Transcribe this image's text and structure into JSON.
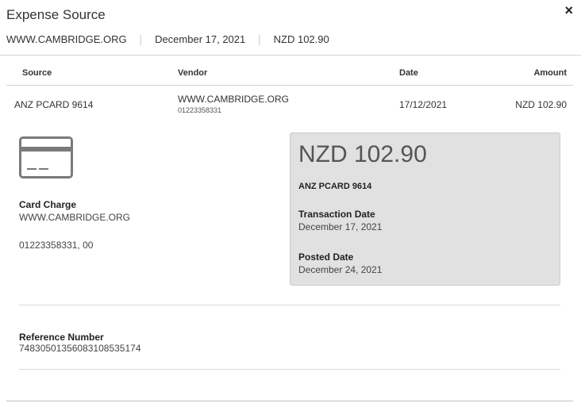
{
  "header": {
    "title": "Expense Source",
    "close_glyph": "×",
    "vendor": "WWW.CAMBRIDGE.ORG",
    "date": "December 17, 2021",
    "amount": "NZD 102.90",
    "separator": "|"
  },
  "table": {
    "columns": [
      "Source",
      "Vendor",
      "Date",
      "Amount"
    ],
    "row": {
      "source": "ANZ PCARD 9614",
      "vendor": "WWW.CAMBRIDGE.ORG",
      "vendor_phone": "01223358331",
      "date": "17/12/2021",
      "amount": "NZD 102.90"
    }
  },
  "details": {
    "icon": "credit-card-icon",
    "charge_label": "Card Charge",
    "charge_vendor": "WWW.CAMBRIDGE.ORG",
    "charge_ref": "01223358331, 00"
  },
  "panel": {
    "amount": "NZD 102.90",
    "card": "ANZ PCARD 9614",
    "transaction_date_label": "Transaction Date",
    "transaction_date": "December 17, 2021",
    "posted_date_label": "Posted Date",
    "posted_date": "December 24, 2021"
  },
  "reference": {
    "label": "Reference Number",
    "value": "74830501356083108535174"
  }
}
